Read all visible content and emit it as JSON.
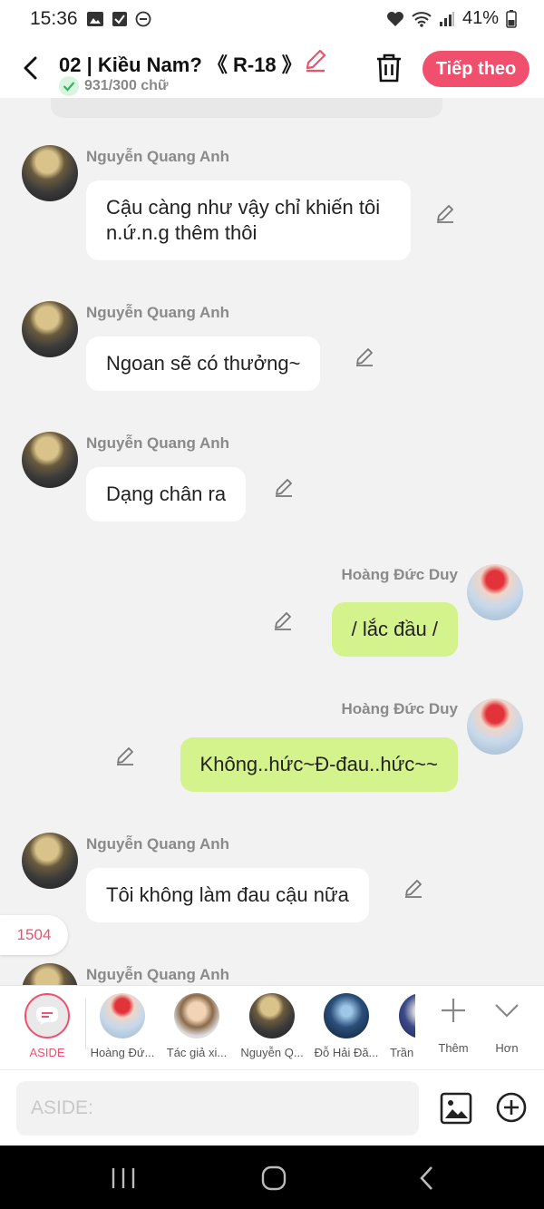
{
  "status_bar": {
    "time": "15:36",
    "battery": "41%"
  },
  "header": {
    "title": "02 | Kiều Nam? 《 R-18 》",
    "word_count": "931/300 chữ",
    "next_label": "Tiếp theo"
  },
  "messages": [
    {
      "sender": "Nguyễn Quang Anh",
      "text": "Cậu càng như vậy chỉ khiến tôi n.ứ.n.g thêm thôi"
    },
    {
      "sender": "Nguyễn Quang Anh",
      "text": "Ngoan sẽ có thưởng~"
    },
    {
      "sender": "Nguyễn Quang Anh",
      "text": "Dạng chân ra"
    },
    {
      "sender": "Hoàng Đức Duy",
      "text": "/ lắc đầu /"
    },
    {
      "sender": "Hoàng Đức Duy",
      "text": "Không..hức~Đ-đau..hức~~"
    },
    {
      "sender": "Nguyễn Quang Anh",
      "text": "Tôi không làm đau cậu nữa"
    },
    {
      "sender": "Nguyễn Quang Anh",
      "text": ""
    }
  ],
  "page_badge": "1504",
  "characters": [
    {
      "label": "ASIDE"
    },
    {
      "label": "Hoàng Đứ..."
    },
    {
      "label": "Tác giả xi..."
    },
    {
      "label": "Nguyễn Q..."
    },
    {
      "label": "Đỗ Hải Đă..."
    },
    {
      "label": "Trần"
    }
  ],
  "tools": {
    "add_label": "Thêm",
    "more_label": "Hơn"
  },
  "input": {
    "placeholder": "ASIDE:"
  },
  "colors": {
    "accent": "#f0506e",
    "my_bubble": "#d5f38c",
    "bubble": "#ffffff",
    "background": "#f2f2f2"
  }
}
